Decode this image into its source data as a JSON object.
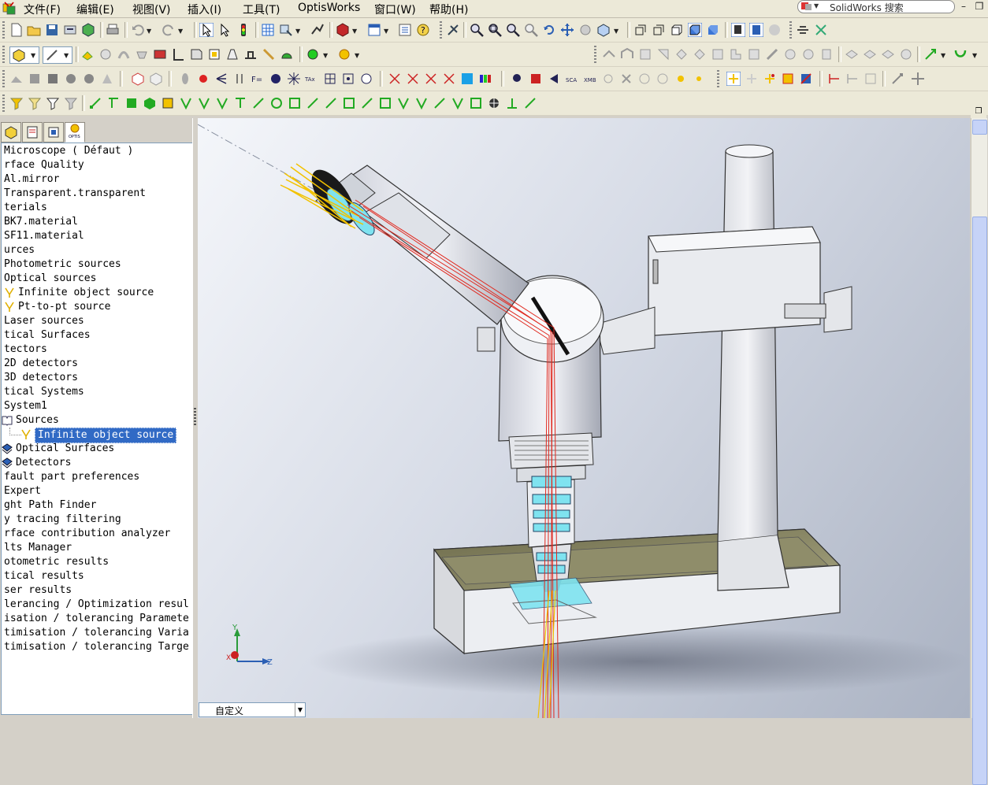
{
  "menubar": {
    "items": [
      "文件(F)",
      "编辑(E)",
      "视图(V)",
      "插入(I)",
      "工具(T)",
      "OptisWorks",
      "窗口(W)",
      "帮助(H)"
    ],
    "search_label": "SolidWorks 搜索"
  },
  "feature_tabs": [
    "feature-manager",
    "property-manager",
    "configuration-manager",
    "OPTIS"
  ],
  "tree": {
    "items": [
      {
        "label": "Microscope ( Défaut )",
        "indent": 0
      },
      {
        "label": "rface Quality",
        "indent": 0
      },
      {
        "label": "Al.mirror",
        "indent": 0
      },
      {
        "label": "Transparent.transparent",
        "indent": 0
      },
      {
        "label": "terials",
        "indent": 0
      },
      {
        "label": "BK7.material",
        "indent": 0
      },
      {
        "label": "SF11.material",
        "indent": 0
      },
      {
        "label": "urces",
        "indent": 0
      },
      {
        "label": "Photometric sources",
        "indent": 0
      },
      {
        "label": "Optical sources",
        "indent": 0
      },
      {
        "label": "Infinite object source",
        "indent": 1,
        "icon": "source-arrow-icon"
      },
      {
        "label": "Pt-to-pt source",
        "indent": 1,
        "icon": "source-arrow-icon"
      },
      {
        "label": "Laser sources",
        "indent": 0
      },
      {
        "label": "tical Surfaces",
        "indent": 0
      },
      {
        "label": "tectors",
        "indent": 0
      },
      {
        "label": "2D detectors",
        "indent": 0
      },
      {
        "label": "3D detectors",
        "indent": 0
      },
      {
        "label": "tical Systems",
        "indent": 0
      },
      {
        "label": "System1",
        "indent": 0
      },
      {
        "label": "Sources",
        "indent": 0,
        "icon": "book-icon"
      },
      {
        "label": "Infinite object source",
        "indent": 2,
        "icon": "source-arrow-icon",
        "selected": true
      },
      {
        "label": "Optical Surfaces",
        "indent": 0,
        "icon": "surface-icon"
      },
      {
        "label": "Detectors",
        "indent": 0,
        "icon": "surface-icon"
      },
      {
        "label": "fault part preferences",
        "indent": 0
      },
      {
        "label": "Expert",
        "indent": 0
      },
      {
        "label": "ght Path Finder",
        "indent": 0
      },
      {
        "label": "y tracing filtering",
        "indent": 0
      },
      {
        "label": "rface contribution analyzer",
        "indent": 0
      },
      {
        "label": "lts Manager",
        "indent": 0
      },
      {
        "label": "otometric results",
        "indent": 0
      },
      {
        "label": "tical results",
        "indent": 0
      },
      {
        "label": "ser results",
        "indent": 0
      },
      {
        "label": "lerancing / Optimization resul",
        "indent": 0
      },
      {
        "label": "isation / tolerancing Paramete",
        "indent": 0
      },
      {
        "label": "timisation / tolerancing Varia",
        "indent": 0
      },
      {
        "label": "timisation / tolerancing Targe",
        "indent": 0
      }
    ]
  },
  "viewport": {
    "triad_labels": {
      "x": "X",
      "y": "Y",
      "z": "Z"
    },
    "view_selector": "自定义"
  },
  "colors": {
    "selection": "#316ac5",
    "ray_red": "#e0281e",
    "ray_yellow": "#f2c200",
    "lens_cyan": "#7fe3f0",
    "base_olive": "#8f8d6a"
  }
}
